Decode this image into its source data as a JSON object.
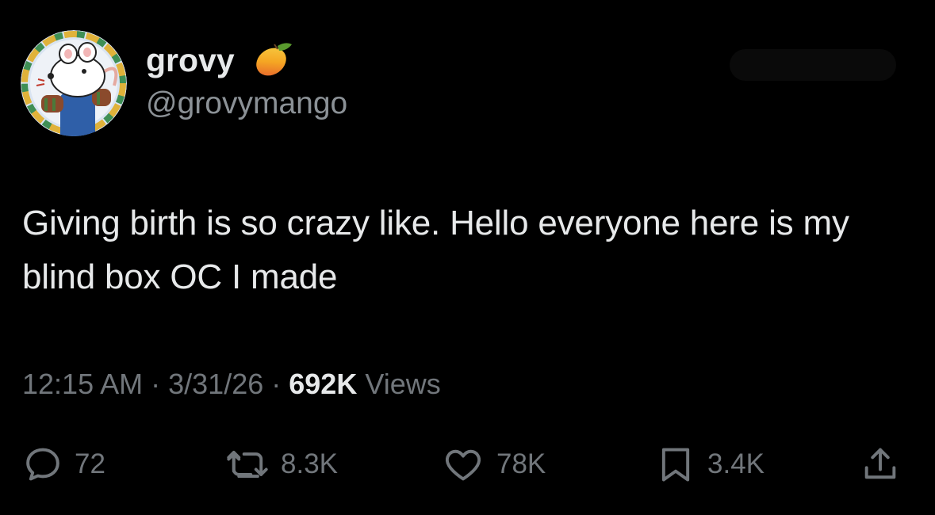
{
  "user": {
    "display_name": "grovy",
    "badge_icon": "mango-emoji-icon",
    "handle": "@grovymango",
    "avatar_icon": "mouse-character-avatar"
  },
  "tweet": {
    "text": "Giving birth is so crazy like. Hello everyone here is my blind box OC I made",
    "time": "12:15 AM",
    "date": "3/31/26",
    "separator": "·",
    "views_count": "692K",
    "views_label": "Views"
  },
  "actions": {
    "reply": {
      "icon": "reply-bubble-icon",
      "count": "72"
    },
    "retweet": {
      "icon": "retweet-icon",
      "count": "8.3K"
    },
    "like": {
      "icon": "heart-icon",
      "count": "78K"
    },
    "bookmark": {
      "icon": "bookmark-icon",
      "count": "3.4K"
    },
    "share": {
      "icon": "share-icon"
    }
  },
  "colors": {
    "background": "#000000",
    "primary_text": "#e7e9ea",
    "secondary_text": "#71767b"
  }
}
